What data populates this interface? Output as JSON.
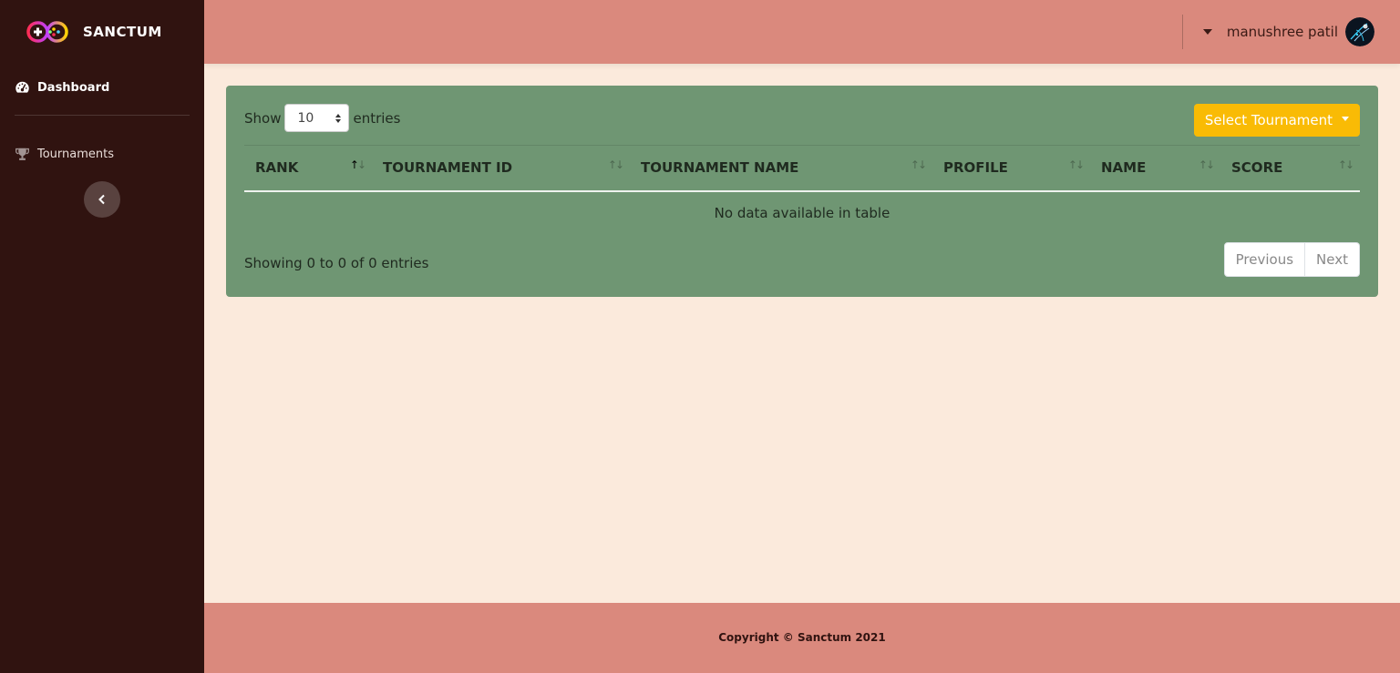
{
  "brand": {
    "name": "SANCTUM",
    "logo_icon": "gamepad-infinity-icon"
  },
  "sidebar": {
    "items": [
      {
        "label": "Dashboard",
        "icon": "dashboard-gauge-icon"
      },
      {
        "label": "Tournaments",
        "icon": "trophy-icon"
      }
    ],
    "toggle_icon": "chevron-left-icon"
  },
  "topbar": {
    "user_name": "manushree patil",
    "avatar_icon": "avatar-image"
  },
  "table_controls": {
    "show_label": "Show",
    "entries_value": "10",
    "entries_label": "entries",
    "select_tournament_label": "Select Tournament"
  },
  "table": {
    "columns": [
      "RANK",
      "TOURNAMENT ID",
      "TOURNAMENT NAME",
      "PROFILE",
      "NAME",
      "SCORE"
    ],
    "sorted_column": "RANK",
    "empty_message": "No data available in table"
  },
  "pagination": {
    "info": "Showing 0 to 0 of 0 entries",
    "previous_label": "Previous",
    "next_label": "Next"
  },
  "footer": {
    "copyright": "Copyright © Sanctum 2021"
  },
  "colors": {
    "sidebar_bg": "#301310",
    "topbar_bg": "#da897d",
    "page_bg": "#fbeadc",
    "card_bg": "#6f9673",
    "button_accent": "#f9bb05"
  }
}
